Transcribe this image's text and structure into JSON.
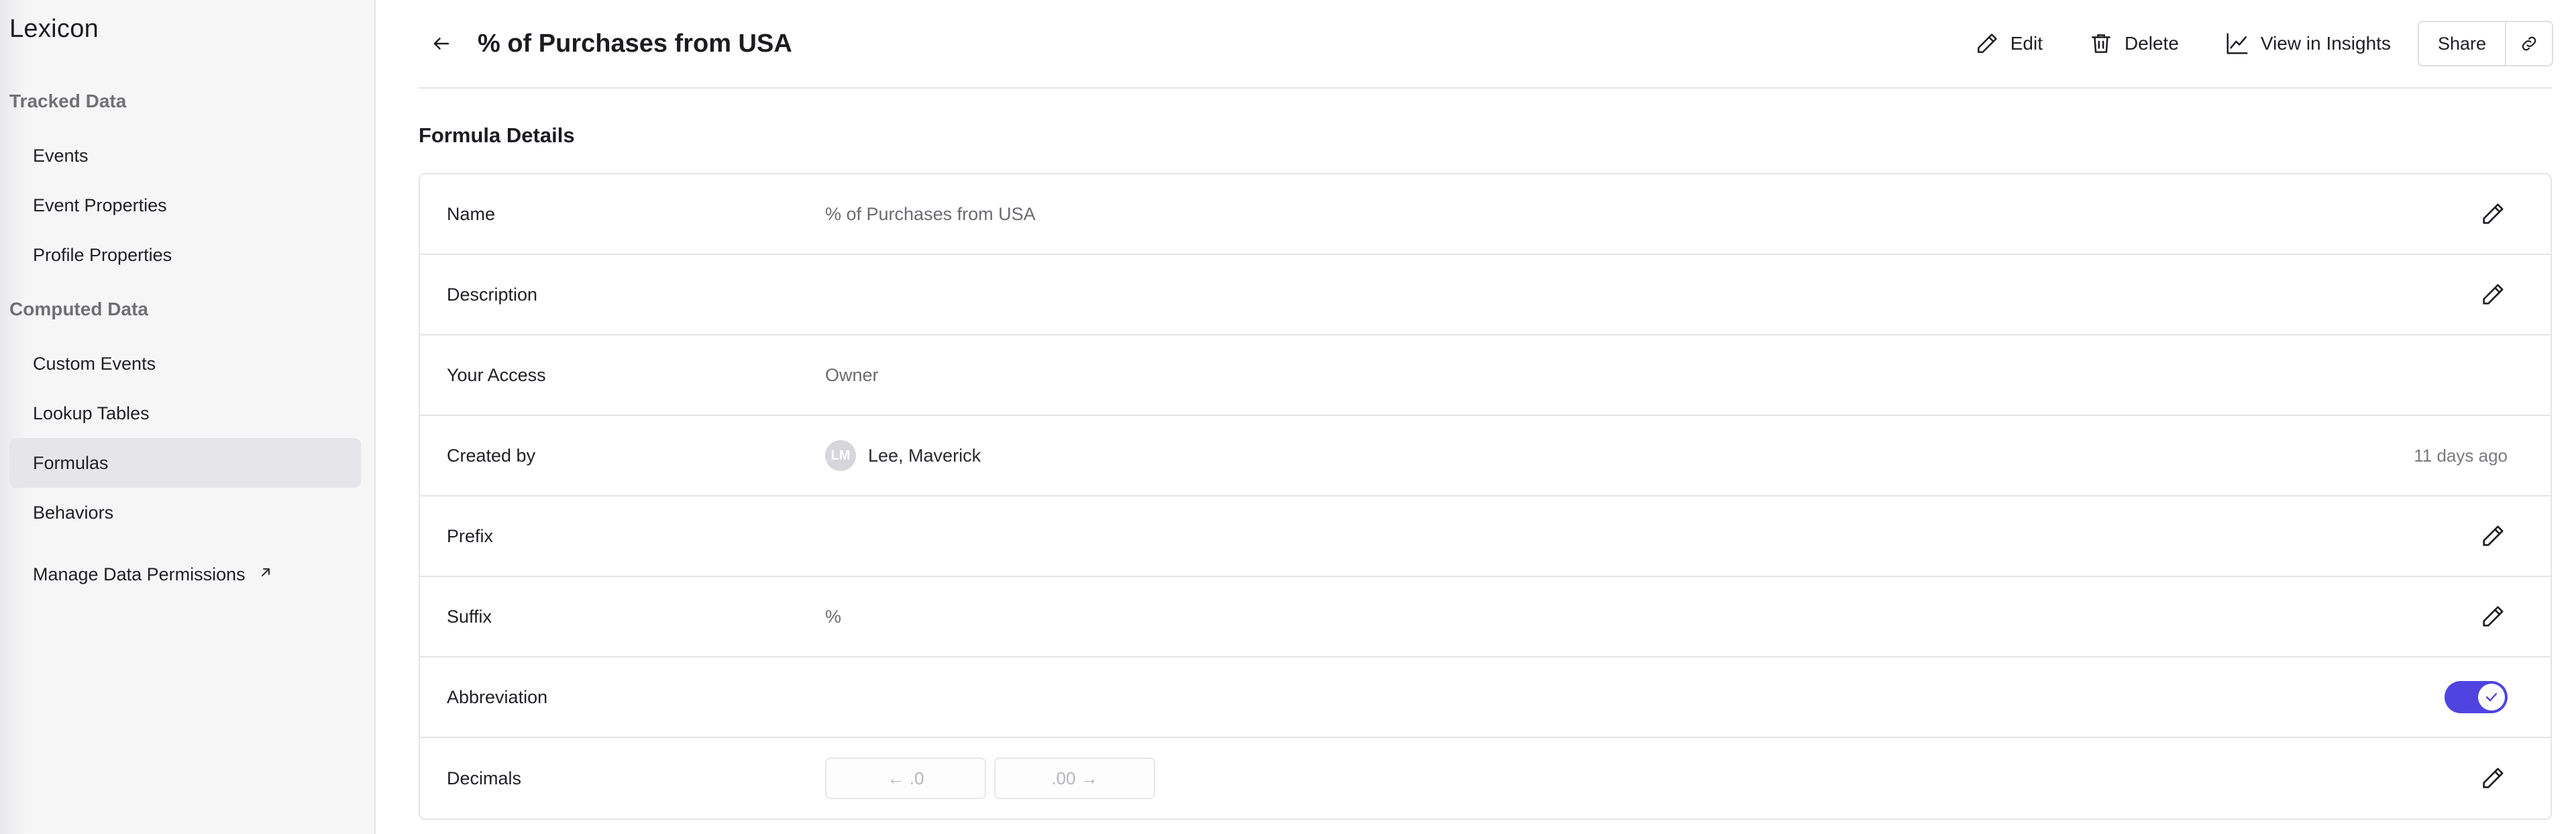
{
  "sidebar": {
    "title": "Lexicon",
    "tracked_heading": "Tracked Data",
    "tracked_items": [
      "Events",
      "Event Properties",
      "Profile Properties"
    ],
    "computed_heading": "Computed Data",
    "computed_items": [
      "Custom Events",
      "Lookup Tables",
      "Formulas",
      "Behaviors"
    ],
    "active_item": "Formulas",
    "manage_permissions": "Manage Data Permissions"
  },
  "header": {
    "title": "% of Purchases from USA",
    "edit_label": "Edit",
    "delete_label": "Delete",
    "insights_label": "View in Insights",
    "share_label": "Share"
  },
  "details": {
    "section_title": "Formula Details",
    "rows": {
      "name": {
        "label": "Name",
        "value": "% of Purchases from USA"
      },
      "description": {
        "label": "Description",
        "value": ""
      },
      "access": {
        "label": "Your Access",
        "value": "Owner"
      },
      "created": {
        "label": "Created by",
        "avatar_initials": "LM",
        "value": "Lee, Maverick",
        "timestamp": "11 days ago"
      },
      "prefix": {
        "label": "Prefix",
        "value": ""
      },
      "suffix": {
        "label": "Suffix",
        "value": "%"
      },
      "abbreviation": {
        "label": "Abbreviation",
        "enabled": true
      },
      "decimals": {
        "label": "Decimals",
        "decrease_label": "← .0",
        "increase_label": ".00 →"
      }
    }
  },
  "colors": {
    "accent": "#4f44e0",
    "sidebar_bg": "#f6f6f7",
    "active_nav_bg": "#e6e6ea",
    "border": "#e4e4e8"
  }
}
